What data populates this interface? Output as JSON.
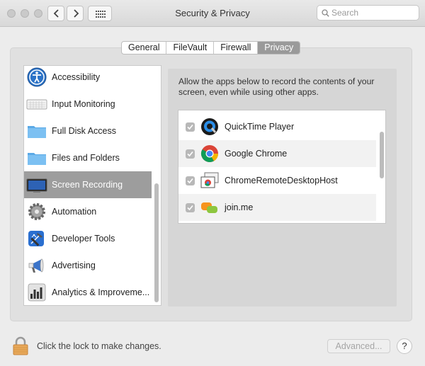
{
  "window": {
    "title": "Security & Privacy",
    "search_placeholder": "Search"
  },
  "tabs": [
    {
      "label": "General"
    },
    {
      "label": "FileVault"
    },
    {
      "label": "Firewall"
    },
    {
      "label": "Privacy",
      "active": true
    }
  ],
  "sidebar": {
    "items": [
      {
        "label": "Accessibility",
        "icon": "accessibility-icon"
      },
      {
        "label": "Input Monitoring",
        "icon": "keyboard-icon"
      },
      {
        "label": "Full Disk Access",
        "icon": "folder-icon"
      },
      {
        "label": "Files and Folders",
        "icon": "folder-icon"
      },
      {
        "label": "Screen Recording",
        "icon": "display-icon",
        "selected": true
      },
      {
        "label": "Automation",
        "icon": "gear-icon"
      },
      {
        "label": "Developer Tools",
        "icon": "hammer-icon"
      },
      {
        "label": "Advertising",
        "icon": "megaphone-icon"
      },
      {
        "label": "Analytics & Improveme...",
        "icon": "chart-icon"
      }
    ]
  },
  "content": {
    "description": "Allow the apps below to record the contents of your screen, even while using other apps.",
    "apps": [
      {
        "name": "QuickTime Player",
        "checked": true,
        "icon": "quicktime-icon"
      },
      {
        "name": "Google Chrome",
        "checked": true,
        "icon": "chrome-icon"
      },
      {
        "name": "ChromeRemoteDesktopHost",
        "checked": true,
        "icon": "remote-desktop-icon"
      },
      {
        "name": "join.me",
        "checked": true,
        "icon": "joinme-icon"
      }
    ]
  },
  "footer": {
    "lock_text": "Click the lock to make changes.",
    "advanced_label": "Advanced...",
    "help_label": "?"
  },
  "colors": {
    "selected_row": "#9d9d9d",
    "active_tab": "#9a9a9a",
    "window_bg": "#ececec"
  }
}
